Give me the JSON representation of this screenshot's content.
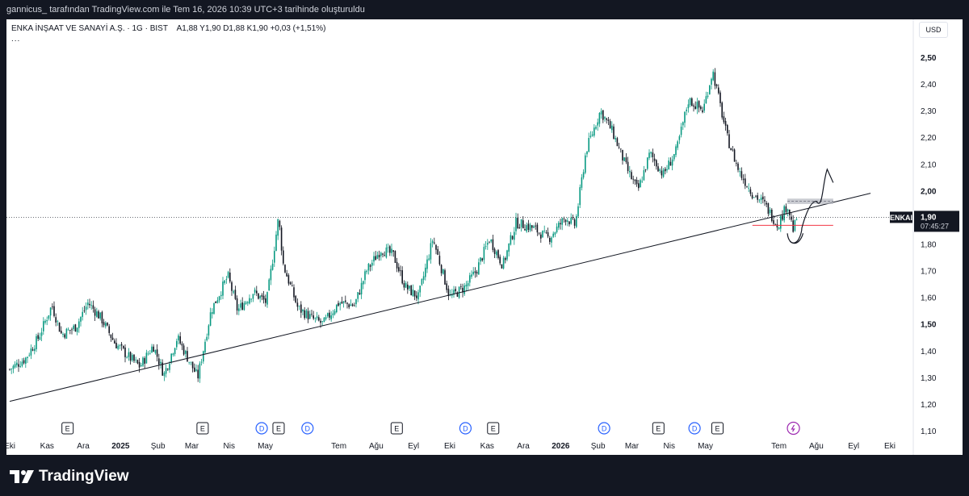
{
  "header": {
    "attribution": "gannicus_ tarafından TradingView.com ile Tem 16, 2026 10:39 UTC+3 tarihinde oluşturuldu"
  },
  "legend": {
    "title": "ENKA İNŞAAT VE SANAYİ A.Ş. · 1G · BIST",
    "ohlc": "A1,88  Y1,90  D1,88  K1,90  +0,03 (+1,51%)",
    "more": "..."
  },
  "currency_button": "USD",
  "price_tag": {
    "symbol": "ENKAI",
    "price": "1,90",
    "countdown": "07:45:27"
  },
  "footer": {
    "brand": "TradingView",
    "logo_icon": "tradingview-logo-icon"
  },
  "colors": {
    "up": "#089981",
    "down": "#131722",
    "trendline": "#131722",
    "support_line": "#f23645",
    "zone": "#b2b5be",
    "dividend_badge": "#2962ff",
    "split_badge": "#9c27b0"
  },
  "chart_data": {
    "type": "candlestick",
    "symbol": "ENKAI",
    "interval": "1D",
    "y_axis": {
      "min": 1.1,
      "max": 2.5,
      "ticks": [
        "2,50",
        "2,40",
        "2,30",
        "2,20",
        "2,10",
        "2,00",
        "1,90",
        "1,80",
        "1,70",
        "1,60",
        "1,50",
        "1,40",
        "1,30",
        "1,20",
        "1,10"
      ]
    },
    "x_axis": {
      "ticks": [
        "Eki",
        "Kas",
        "Ara",
        "2025",
        "Şub",
        "Mar",
        "Nis",
        "May",
        "Tem",
        "Ağu",
        "Eyl",
        "Eki",
        "Kas",
        "Ara",
        "2026",
        "Şub",
        "Mar",
        "Nis",
        "May",
        "Tem",
        "Ağu",
        "Eyl",
        "Eki"
      ]
    },
    "price_path": [
      [
        "2024-10-01",
        1.33
      ],
      [
        "2024-10-14",
        1.37
      ],
      [
        "2024-10-25",
        1.45
      ],
      [
        "2024-11-05",
        1.57
      ],
      [
        "2024-11-13",
        1.46
      ],
      [
        "2024-11-25",
        1.49
      ],
      [
        "2024-12-05",
        1.58
      ],
      [
        "2024-12-16",
        1.52
      ],
      [
        "2024-12-27",
        1.43
      ],
      [
        "2025-01-07",
        1.38
      ],
      [
        "2025-01-17",
        1.34
      ],
      [
        "2025-01-28",
        1.42
      ],
      [
        "2025-02-06",
        1.31
      ],
      [
        "2025-02-17",
        1.45
      ],
      [
        "2025-02-27",
        1.36
      ],
      [
        "2025-03-06",
        1.3
      ],
      [
        "2025-03-17",
        1.55
      ],
      [
        "2025-03-31",
        1.68
      ],
      [
        "2025-04-08",
        1.55
      ],
      [
        "2025-04-21",
        1.62
      ],
      [
        "2025-05-02",
        1.58
      ],
      [
        "2025-05-12",
        1.9
      ],
      [
        "2025-05-16",
        1.72
      ],
      [
        "2025-05-28",
        1.56
      ],
      [
        "2025-06-09",
        1.52
      ],
      [
        "2025-06-18",
        1.5
      ],
      [
        "2025-07-01",
        1.58
      ],
      [
        "2025-07-14",
        1.57
      ],
      [
        "2025-07-24",
        1.7
      ],
      [
        "2025-08-05",
        1.78
      ],
      [
        "2025-08-15",
        1.76
      ],
      [
        "2025-08-25",
        1.64
      ],
      [
        "2025-09-05",
        1.6
      ],
      [
        "2025-09-17",
        1.82
      ],
      [
        "2025-10-01",
        1.6
      ],
      [
        "2025-10-14",
        1.64
      ],
      [
        "2025-10-23",
        1.7
      ],
      [
        "2025-11-03",
        1.82
      ],
      [
        "2025-11-14",
        1.72
      ],
      [
        "2025-11-25",
        1.88
      ],
      [
        "2025-12-09",
        1.86
      ],
      [
        "2025-12-22",
        1.82
      ],
      [
        "2026-01-05",
        1.9
      ],
      [
        "2026-01-13",
        1.87
      ],
      [
        "2026-01-22",
        2.15
      ],
      [
        "2026-02-03",
        2.3
      ],
      [
        "2026-02-13",
        2.22
      ],
      [
        "2026-02-25",
        2.08
      ],
      [
        "2026-03-06",
        2.0
      ],
      [
        "2026-03-16",
        2.14
      ],
      [
        "2026-03-27",
        2.06
      ],
      [
        "2026-04-07",
        2.15
      ],
      [
        "2026-04-17",
        2.34
      ],
      [
        "2026-04-29",
        2.3
      ],
      [
        "2026-05-07",
        2.45
      ],
      [
        "2026-05-19",
        2.2
      ],
      [
        "2026-05-29",
        2.07
      ],
      [
        "2026-06-09",
        1.99
      ],
      [
        "2026-06-19",
        1.95
      ],
      [
        "2026-06-30",
        1.87
      ],
      [
        "2026-07-08",
        1.95
      ],
      [
        "2026-07-13",
        1.85
      ],
      [
        "2026-07-16",
        1.9
      ]
    ],
    "current_price": 1.9,
    "open": 1.88,
    "high": 1.9,
    "low": 1.88,
    "close": 1.9,
    "change": 0.03,
    "change_pct": 1.51,
    "annotations": {
      "trendline": {
        "from": [
          "2024-10-01",
          1.21
        ],
        "to": [
          "2026-09-15",
          1.99
        ]
      },
      "support_level": {
        "price": 1.87,
        "from": "2026-06-09",
        "to": "2026-08-15"
      },
      "resistance_zone": {
        "low": 1.95,
        "high": 1.97,
        "from": "2026-07-08",
        "to": "2026-08-15"
      },
      "projected_path": [
        [
          "2026-07-10",
          1.81
        ],
        [
          "2026-07-20",
          1.86
        ],
        [
          "2026-08-01",
          1.96
        ],
        [
          "2026-08-10",
          2.08
        ],
        [
          "2026-08-15",
          2.03
        ]
      ]
    },
    "events": [
      {
        "date": "2024-11-18",
        "type": "E"
      },
      {
        "date": "2025-03-10",
        "type": "E"
      },
      {
        "date": "2025-04-28",
        "type": "D"
      },
      {
        "date": "2025-05-12",
        "type": "E"
      },
      {
        "date": "2025-06-05",
        "type": "D"
      },
      {
        "date": "2025-08-18",
        "type": "E"
      },
      {
        "date": "2025-10-14",
        "type": "D"
      },
      {
        "date": "2025-11-06",
        "type": "E"
      },
      {
        "date": "2026-02-06",
        "type": "D"
      },
      {
        "date": "2026-03-23",
        "type": "E"
      },
      {
        "date": "2026-04-22",
        "type": "D"
      },
      {
        "date": "2026-05-11",
        "type": "E"
      },
      {
        "date": "2026-07-13",
        "type": "split"
      }
    ]
  }
}
